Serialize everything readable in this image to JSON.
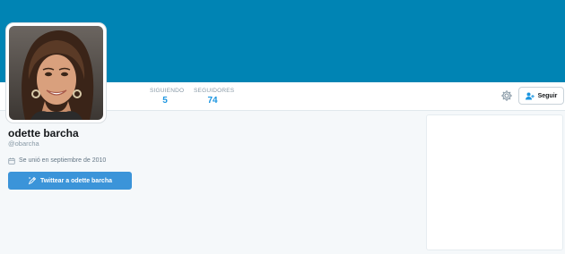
{
  "profile": {
    "name": "odette barcha",
    "handle": "@obarcha",
    "joined": "Se unió en septiembre de 2010",
    "avatar_icon": "profile-photo"
  },
  "stats": {
    "following": {
      "label": "SIGUIENDO",
      "value": "5"
    },
    "followers": {
      "label": "SEGUIDORES",
      "value": "74"
    }
  },
  "actions": {
    "follow_label": "Seguir",
    "tweet_to_label": "Twittear a odette barcha",
    "settings_icon": "gear-icon",
    "follow_icon": "add-user-icon",
    "tweet_icon": "compose-icon",
    "calendar_icon": "calendar-icon"
  },
  "colors": {
    "banner": "#0084b4",
    "accent": "#1b95e0",
    "tweet_button": "#3b94d9",
    "page_background": "#f5f8fa"
  }
}
